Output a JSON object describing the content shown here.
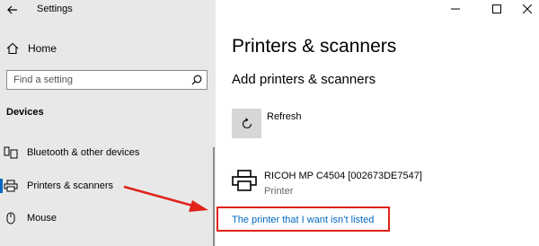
{
  "window": {
    "title": "Settings",
    "controls": [
      "minimize-icon",
      "maximize-icon",
      "close-icon"
    ]
  },
  "sidebar": {
    "home_label": "Home",
    "search": {
      "placeholder": "Find a setting"
    },
    "section_label": "Devices",
    "items": [
      {
        "label": "Bluetooth & other devices",
        "icon": "bluetooth-devices-icon"
      },
      {
        "label": "Printers & scanners",
        "icon": "printer-icon",
        "selected": true
      },
      {
        "label": "Mouse",
        "icon": "mouse-icon"
      }
    ]
  },
  "main": {
    "title": "Printers & scanners",
    "subtitle": "Add printers & scanners",
    "refresh_label": "Refresh",
    "printer": {
      "name": "RICOH MP C4504 [002673DE7547]",
      "status": "Printer"
    },
    "not_listed_link": "The printer that I want isn’t listed"
  },
  "annotation": {
    "highlight_color": "#e0231b"
  },
  "colors": {
    "accent": "#0067c0",
    "sidebar_bg": "#e8e8e8"
  }
}
